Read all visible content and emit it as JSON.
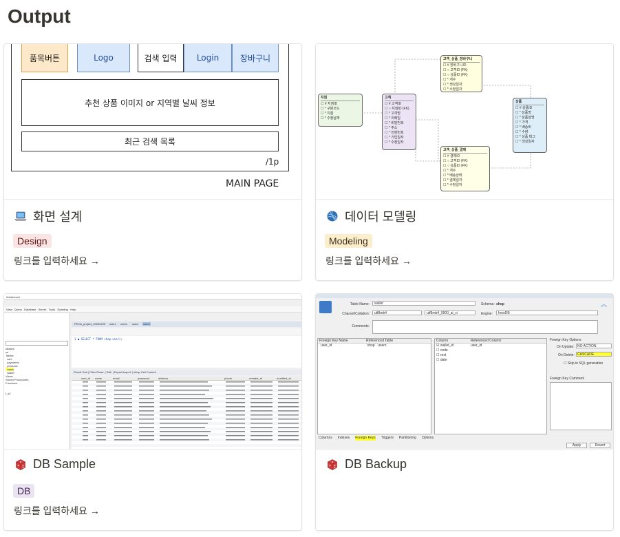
{
  "page": {
    "title": "Output"
  },
  "cards": [
    {
      "title": "화면 설계",
      "icon": "laptop-icon",
      "tag": {
        "label": "Design",
        "bg": "#fbe4e4"
      },
      "link": "링크를 입력하세요 →",
      "wireframe": {
        "b1": "품목버튼",
        "b2": "Logo",
        "b3": "검색 입력",
        "b4": "Login",
        "b5": "장바구니",
        "banner": "추천 상품 이미지 or 지역별 날씨 정보",
        "recent": "최근 검색 목록",
        "page": "/1p",
        "caption": "MAIN PAGE"
      }
    },
    {
      "title": "데이터 모델링",
      "icon": "yarn-ball-icon",
      "tag": {
        "label": "Modeling",
        "bg": "#fbeecc"
      },
      "link": "링크를 입력하세요 →",
      "er": {
        "e_cart": "고객_상품_장바구니",
        "e_region": "지점",
        "e_customer": "고객",
        "e_product": "상품",
        "e_payment": "고객_상품_결제"
      }
    },
    {
      "title": "DB Sample",
      "icon": "dice-icon",
      "tag": {
        "label": "DB",
        "bg": "#eae4f2"
      },
      "link": "링크를 입력하세요 →",
      "wb": {
        "tab": "PECA_project_20230425",
        "sql": "SELECT * FROM shop.users;",
        "cols": [
          "user_id",
          "name",
          "email",
          "password",
          "address",
          "phone",
          "created_at",
          "modified_at"
        ]
      }
    },
    {
      "title": "DB Backup",
      "icon": "dice-icon",
      "tag": {
        "label": "",
        "bg": ""
      },
      "link": "",
      "bk": {
        "table_name_label": "Table Name:",
        "table_name": "wallet",
        "schema_label": "Schema:",
        "schema": "shop",
        "charset_label": "Charset/Collation:",
        "charset": "utf8mb4",
        "collation": "utf8mb4_0900_ai_ci",
        "engine_label": "Engine:",
        "engine": "InnoDB",
        "comments_label": "Comments:",
        "fk_col1": "Foreign Key Name",
        "fk_col2": "Referenced Table",
        "fk_name": "user_id",
        "fk_ref": "`shop`.`users`",
        "col_h1": "Column",
        "col_h2": "Referenced Column",
        "cols": [
          "wallet_id",
          "code",
          "rest",
          "date"
        ],
        "ref_col": "user_id",
        "opt_title": "Foreign Key Options",
        "on_update_label": "On Update:",
        "on_update": "NO ACTION",
        "on_delete_label": "On Delete:",
        "on_delete": "CASCADE",
        "skip": "Skip in SQL generation",
        "fk_comment": "Foreign Key Comment",
        "tabs": [
          "Columns",
          "Indexes",
          "Foreign Keys",
          "Triggers",
          "Partitioning",
          "Options"
        ],
        "apply": "Apply",
        "revert": "Revert"
      }
    }
  ]
}
